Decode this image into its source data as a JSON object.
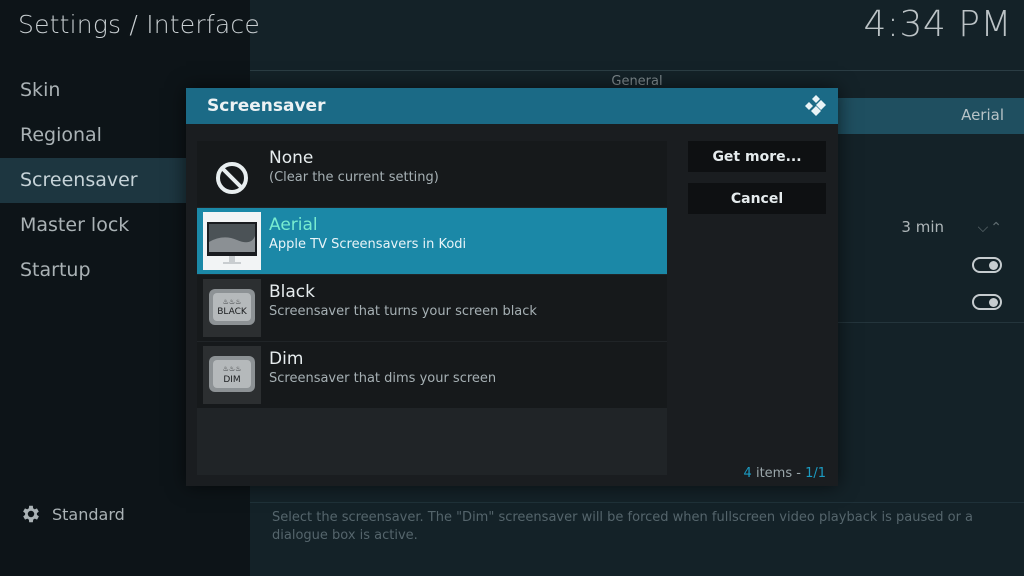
{
  "header": {
    "title": "Settings / Interface",
    "clock": "4:34 PM"
  },
  "sidebar": {
    "items": [
      {
        "label": "Skin"
      },
      {
        "label": "Regional"
      },
      {
        "label": "Screensaver"
      },
      {
        "label": "Master lock"
      },
      {
        "label": "Startup"
      }
    ],
    "active_index": 2,
    "footer_label": "Standard"
  },
  "main": {
    "section_label": "General",
    "screensaver_mode_value": "Aerial",
    "wait_time_value": "3 min",
    "description": "Select the screensaver. The \"Dim\" screensaver will be forced when fullscreen video playback is paused or a dialogue box is active."
  },
  "dialog": {
    "title": "Screensaver",
    "items": [
      {
        "name": "None",
        "desc": "(Clear the current setting)",
        "icon": "no-entry-icon"
      },
      {
        "name": "Aerial",
        "desc": "Apple TV Screensavers in Kodi",
        "icon": "monitor-thumbnail"
      },
      {
        "name": "Black",
        "desc": "Screensaver that turns your screen black",
        "icon": "black-addon-thumbnail",
        "thumb_text": "BLACK"
      },
      {
        "name": "Dim",
        "desc": "Screensaver that dims your screen",
        "icon": "dim-addon-thumbnail",
        "thumb_text": "DIM"
      }
    ],
    "focused_index": 1,
    "buttons": {
      "get_more": "Get more...",
      "cancel": "Cancel"
    },
    "count": {
      "num": "4",
      "label": "items -",
      "page": "1/1"
    }
  },
  "colors": {
    "accent": "#1b88a7",
    "header": "#1b6a86",
    "focus_text": "#78ecd0"
  }
}
